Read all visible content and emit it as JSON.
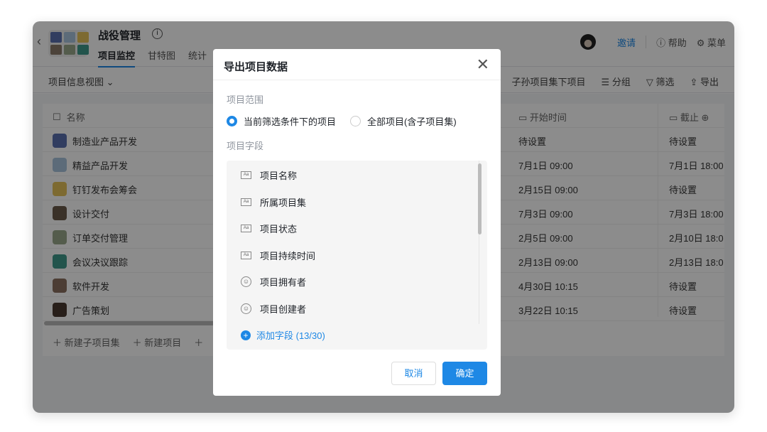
{
  "header": {
    "title": "战役管理",
    "tabs": [
      "项目监控",
      "甘特图",
      "统计"
    ],
    "invite": "邀请",
    "help": "帮助",
    "menu": "菜单"
  },
  "toolbar": {
    "view": "项目信息视图",
    "include": "子孙项目集下项目",
    "group": "分组",
    "filter": "筛选",
    "export": "导出"
  },
  "table": {
    "columns": [
      "名称",
      "开始时间",
      "截止"
    ],
    "rows": [
      {
        "name": "制造业产品开发",
        "start": "待设置",
        "end": "待设置",
        "color": "#5a6fb0"
      },
      {
        "name": "精益产品开发",
        "start": "7月1日 09:00",
        "end": "7月1日 18:00",
        "color": "#a8c4dc"
      },
      {
        "name": "钉钉发布会筹会",
        "start": "2月15日 09:00",
        "end": "待设置",
        "color": "#e3c25a"
      },
      {
        "name": "设计交付",
        "start": "7月3日 09:00",
        "end": "7月3日 18:00",
        "color": "#6b5a4a"
      },
      {
        "name": "订单交付管理",
        "start": "2月5日 09:00",
        "end": "2月10日 18:0",
        "color": "#9aa88a"
      },
      {
        "name": "会议决议跟踪",
        "start": "2月13日 09:00",
        "end": "2月13日 18:0",
        "color": "#3f9a8a"
      },
      {
        "name": "软件开发",
        "start": "4月30日 10:15",
        "end": "待设置",
        "color": "#8a7060"
      },
      {
        "name": "广告策划",
        "start": "3月22日 10:15",
        "end": "待设置",
        "color": "#4a3a30"
      }
    ],
    "new_subset": "新建子项目集",
    "new_project": "新建项目"
  },
  "modal": {
    "title": "导出项目数据",
    "scope_label": "项目范围",
    "scope_options": [
      "当前筛选条件下的项目",
      "全部项目(含子项目集)"
    ],
    "fields_label": "项目字段",
    "fields": [
      {
        "name": "项目名称",
        "icon": "text"
      },
      {
        "name": "所属项目集",
        "icon": "text"
      },
      {
        "name": "项目状态",
        "icon": "text"
      },
      {
        "name": "项目持续时间",
        "icon": "text"
      },
      {
        "name": "项目拥有者",
        "icon": "person"
      },
      {
        "name": "项目创建者",
        "icon": "person-circle"
      }
    ],
    "add_field": "添加字段 (13/30)",
    "cancel": "取消",
    "confirm": "确定"
  }
}
